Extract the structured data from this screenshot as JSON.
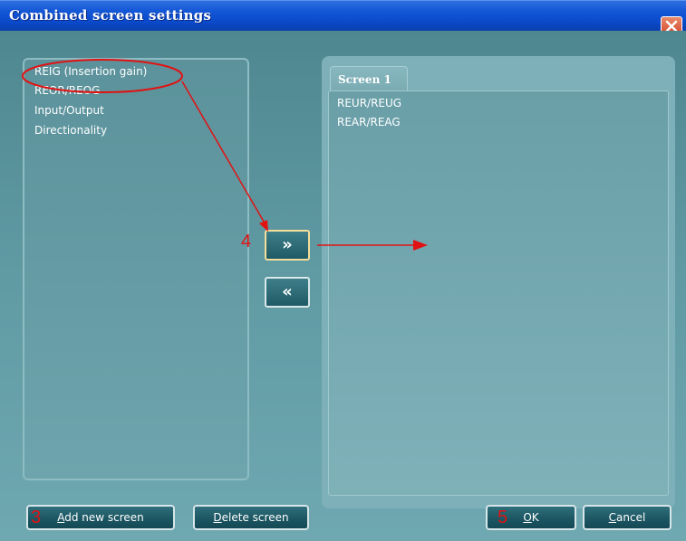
{
  "window": {
    "title": "Combined screen settings",
    "close_icon": "close-icon"
  },
  "available_list": {
    "items": [
      "REIG (Insertion gain)",
      "REOR/REOG",
      "Input/Output",
      "Directionality"
    ]
  },
  "screens": {
    "tabs": [
      "Screen 1"
    ],
    "items": [
      "REUR/REUG",
      "REAR/REAG"
    ]
  },
  "move_buttons": {
    "add_label": "»",
    "remove_label": "«"
  },
  "buttons": {
    "add_new_screen": {
      "label": "Add new screen",
      "accelerator": "A"
    },
    "delete_screen": {
      "label": "Delete screen",
      "accelerator": "D"
    },
    "ok": {
      "label": "OK",
      "accelerator": "O"
    },
    "cancel": {
      "label": "Cancel",
      "accelerator": "C"
    }
  },
  "annotations": {
    "markers": [
      "3",
      "4",
      "5"
    ],
    "color": "#e11212"
  },
  "colors": {
    "titlebar": "#0a49c9",
    "background": "#5a8f98",
    "button": "#1b5561"
  }
}
